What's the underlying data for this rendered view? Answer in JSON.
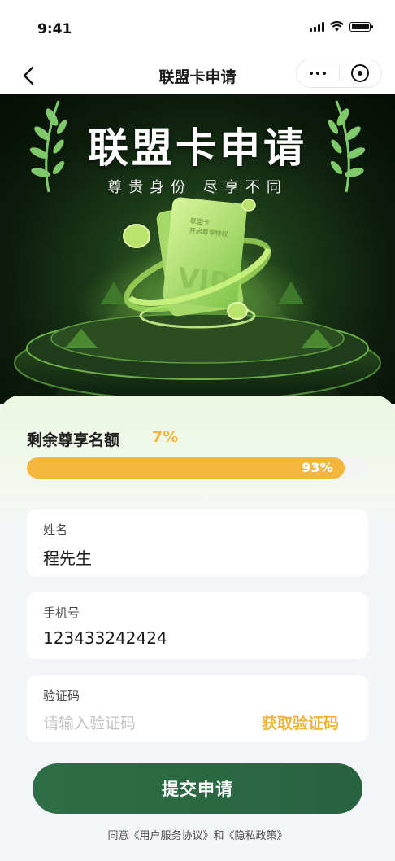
{
  "status_bar": {
    "time": "9:41"
  },
  "nav": {
    "title": "联盟卡申请"
  },
  "banner": {
    "title": "联盟卡申请",
    "subtitle": "尊贵身份 尽享不同",
    "card_text_1": "联盟卡",
    "card_text_2": "开启尊享特权",
    "card_vip": "VIP"
  },
  "quota": {
    "label": "剩余尊享名额",
    "remaining_text": "7%",
    "used_fraction": 0.93,
    "progress_text": "93%"
  },
  "form": {
    "name": {
      "label": "姓名",
      "value": "程先生"
    },
    "phone": {
      "label": "手机号",
      "value": "123433242424"
    },
    "code": {
      "label": "验证码",
      "placeholder": "请输入验证码",
      "action": "获取验证码"
    }
  },
  "submit": {
    "label": "提交申请"
  },
  "agreement": {
    "prefix": "同意",
    "terms": "《用户服务协议》",
    "and": "和",
    "privacy": "《隐私政策》"
  },
  "colors": {
    "accent_gold": "#f4b63d",
    "primary_green": "#2e6e46"
  }
}
